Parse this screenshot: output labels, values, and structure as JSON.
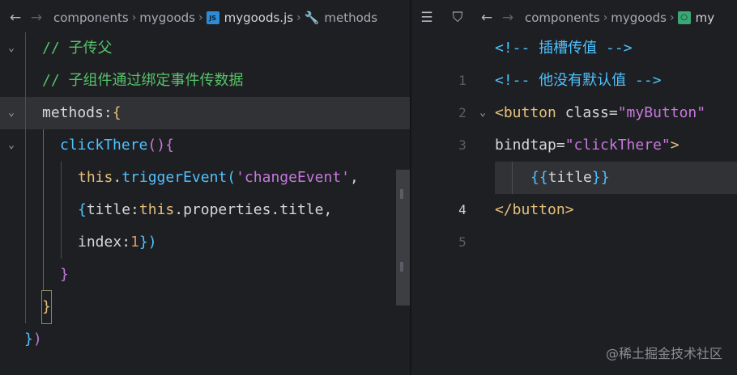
{
  "left_pane": {
    "breadcrumb": [
      "components",
      "mygoods",
      "mygoods.js",
      "methods"
    ],
    "js_badge": "JS",
    "lines": [
      {
        "tokens": [
          {
            "t": "// 子传父",
            "c": "cmt"
          }
        ]
      },
      {
        "tokens": [
          {
            "t": "// 子组件通过绑定事件传数据",
            "c": "cmt"
          }
        ]
      },
      {
        "tokens": [
          {
            "t": "methods",
            "c": "punc"
          },
          {
            "t": ":",
            "c": "punc"
          },
          {
            "t": "{",
            "c": "br1"
          }
        ]
      },
      {
        "tokens": [
          {
            "t": "clickThere",
            "c": "fn"
          },
          {
            "t": "()",
            "c": "br2"
          },
          {
            "t": "{",
            "c": "br2"
          }
        ]
      },
      {
        "tokens": [
          {
            "t": "this",
            "c": "this"
          },
          {
            "t": ".",
            "c": "punc"
          },
          {
            "t": "triggerEvent",
            "c": "fn"
          },
          {
            "t": "(",
            "c": "br3"
          },
          {
            "t": "'changeEvent'",
            "c": "str"
          },
          {
            "t": ",",
            "c": "punc"
          }
        ]
      },
      {
        "tokens": [
          {
            "t": "{",
            "c": "br3"
          },
          {
            "t": "title",
            "c": "punc"
          },
          {
            "t": ":",
            "c": "punc"
          },
          {
            "t": "this",
            "c": "this"
          },
          {
            "t": ".properties.title,",
            "c": "punc"
          }
        ]
      },
      {
        "tokens": [
          {
            "t": "index",
            "c": "punc"
          },
          {
            "t": ":",
            "c": "punc"
          },
          {
            "t": "1",
            "c": "num"
          },
          {
            "t": "}",
            "c": "br3"
          },
          {
            "t": ")",
            "c": "br3"
          }
        ]
      },
      {
        "tokens": [
          {
            "t": "}",
            "c": "br2"
          }
        ]
      },
      {
        "tokens": [
          {
            "t": "}",
            "c": "br1"
          }
        ]
      },
      {
        "tokens": [
          {
            "t": "}",
            "c": "br3"
          },
          {
            "t": ")",
            "c": "br2"
          }
        ]
      }
    ]
  },
  "right_pane": {
    "breadcrumb": [
      "components",
      "mygoods",
      "my"
    ],
    "line_numbers": [
      "1",
      "2",
      "3",
      "",
      "4",
      "5"
    ],
    "lines": [
      {
        "tokens": [
          {
            "t": "<!-- 插槽传值 -->",
            "c": "hcmt"
          }
        ]
      },
      {
        "tokens": [
          {
            "t": "<!-- 他没有默认值 -->",
            "c": "hcmt"
          }
        ]
      },
      {
        "tokens": [
          {
            "t": "<button",
            "c": "tag"
          },
          {
            "t": " class=",
            "c": "attr"
          },
          {
            "t": "\"myButton\"",
            "c": "aval"
          }
        ]
      },
      {
        "tokens": [
          {
            "t": "bindtap=",
            "c": "attr"
          },
          {
            "t": "\"clickThere\"",
            "c": "aval"
          },
          {
            "t": ">",
            "c": "tag"
          }
        ]
      },
      {
        "tokens": [
          {
            "t": "{{",
            "c": "br3"
          },
          {
            "t": "title",
            "c": "punc"
          },
          {
            "t": "}}",
            "c": "br3"
          }
        ]
      },
      {
        "tokens": [
          {
            "t": "</button>",
            "c": "tag"
          }
        ]
      }
    ]
  },
  "watermark": "@稀土掘金技术社区",
  "colors": {
    "background": "#1e1f22",
    "comment": "#56c26a",
    "function": "#4fc1ff",
    "keyword_this": "#e5c07b",
    "string": "#c678dd"
  }
}
